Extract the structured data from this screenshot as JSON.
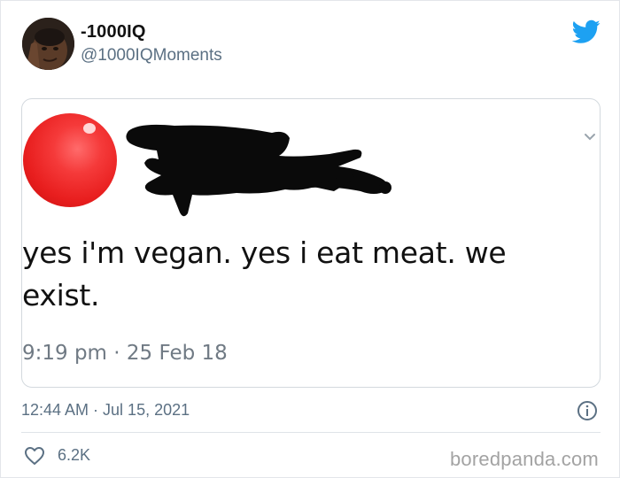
{
  "tweet": {
    "display_name": "-1000IQ",
    "handle": "@1000IQMoments",
    "timestamp": "12:44 AM · Jul 15, 2021",
    "likes": "6.2K"
  },
  "embedded_post": {
    "text": "yes i'm vegan. yes i eat meat. we exist.",
    "time": "9:19 pm · 25 Feb 18"
  },
  "watermark": "boredpanda.com",
  "icons": {
    "brand": "twitter-bird-icon",
    "info": "info-icon",
    "like": "heart-icon",
    "menu": "chevron-down-icon"
  },
  "colors": {
    "twitter_blue": "#1da1f2",
    "secondary_text": "#5b7083",
    "avatar_ball": "#e81e1e"
  }
}
